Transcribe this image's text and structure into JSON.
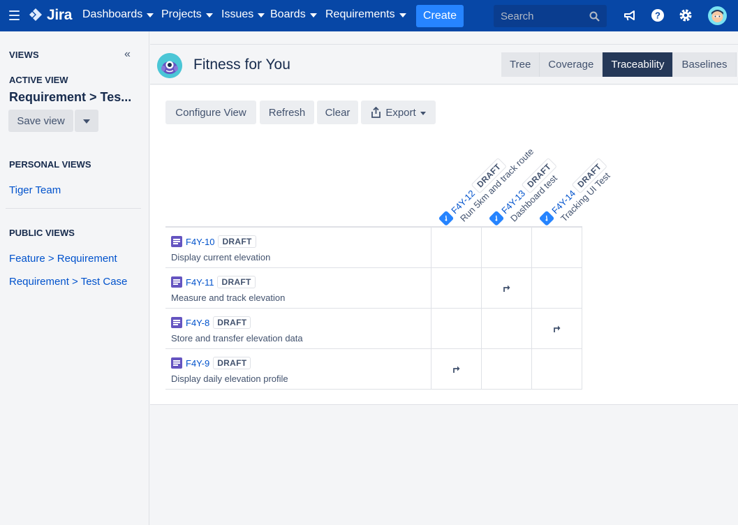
{
  "topnav": {
    "logo": "Jira",
    "items": [
      "Dashboards",
      "Projects",
      "Issues",
      "Boards",
      "Requirements"
    ],
    "create_label": "Create",
    "search_placeholder": "Search"
  },
  "sidebar": {
    "views_label": "VIEWS",
    "active_view_label": "ACTIVE VIEW",
    "active_view_name": "Requirement > Tes...",
    "save_view_label": "Save view",
    "personal_views_label": "PERSONAL VIEWS",
    "personal_views": [
      "Tiger Team"
    ],
    "public_views_label": "PUBLIC VIEWS",
    "public_views": [
      "Feature > Requirement",
      "Requirement > Test Case"
    ]
  },
  "project": {
    "name": "Fitness for You"
  },
  "tabs": [
    {
      "label": "Tree",
      "active": false
    },
    {
      "label": "Coverage",
      "active": false
    },
    {
      "label": "Traceability",
      "active": true
    },
    {
      "label": "Baselines",
      "active": false
    }
  ],
  "toolbar": {
    "configure_label": "Configure View",
    "refresh_label": "Refresh",
    "clear_label": "Clear",
    "export_label": "Export"
  },
  "matrix": {
    "columns": [
      {
        "key": "F4Y-12",
        "status": "DRAFT",
        "summary": "Run 5km and track route"
      },
      {
        "key": "F4Y-13",
        "status": "DRAFT",
        "summary": "Dashboard test"
      },
      {
        "key": "F4Y-14",
        "status": "DRAFT",
        "summary": "Tracking UI Test"
      }
    ],
    "rows": [
      {
        "key": "F4Y-10",
        "status": "DRAFT",
        "summary": "Display current elevation",
        "links": [
          false,
          false,
          false
        ]
      },
      {
        "key": "F4Y-11",
        "status": "DRAFT",
        "summary": "Measure and track elevation",
        "links": [
          false,
          true,
          false
        ]
      },
      {
        "key": "F4Y-8",
        "status": "DRAFT",
        "summary": "Store and transfer elevation data",
        "links": [
          false,
          false,
          true
        ]
      },
      {
        "key": "F4Y-9",
        "status": "DRAFT",
        "summary": "Display daily elevation profile",
        "links": [
          true,
          false,
          false
        ]
      }
    ]
  },
  "colors": {
    "nav_bg": "#0747a6",
    "create_bg": "#2684ff",
    "active_tab_bg": "#253858",
    "link": "#0052cc",
    "story_icon": "#6554c0",
    "test_icon": "#2684ff"
  }
}
